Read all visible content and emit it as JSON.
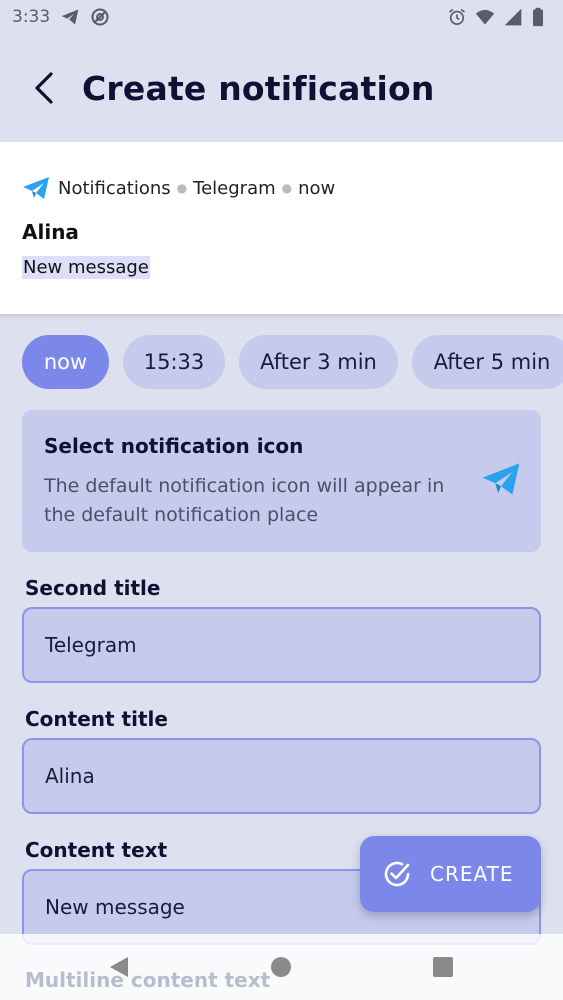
{
  "status_bar": {
    "time": "3:33",
    "icons": [
      "telegram-icon",
      "at-sign-icon",
      "alarm-icon",
      "wifi-icon",
      "signal-icon",
      "battery-icon"
    ]
  },
  "header": {
    "title": "Create notification",
    "back_icon": "back-arrow-icon"
  },
  "preview": {
    "app_icon": "telegram-icon",
    "channel": "Notifications",
    "app": "Telegram",
    "when": "now",
    "title": "Alina",
    "text": "New message"
  },
  "time_chips": [
    {
      "label": "now",
      "selected": true
    },
    {
      "label": "15:33",
      "selected": false
    },
    {
      "label": "After 3 min",
      "selected": false
    },
    {
      "label": "After 5 min",
      "selected": false
    }
  ],
  "icon_card": {
    "title": "Select notification icon",
    "description": "The default notification icon will appear in the default notification place",
    "icon": "telegram-icon"
  },
  "form": {
    "second_title": {
      "label": "Second title",
      "value": "Telegram"
    },
    "content_title": {
      "label": "Content title",
      "value": "Alina"
    },
    "content_text": {
      "label": "Content text",
      "value": "New message"
    },
    "multiline_label": "Multiline content text"
  },
  "fab": {
    "label": "CREATE",
    "icon": "check-circle-icon"
  },
  "colors": {
    "accent": "#7b88ea",
    "chip": "#c6cbee",
    "background": "#dde0ef",
    "telegram": "#2aa3ef"
  }
}
